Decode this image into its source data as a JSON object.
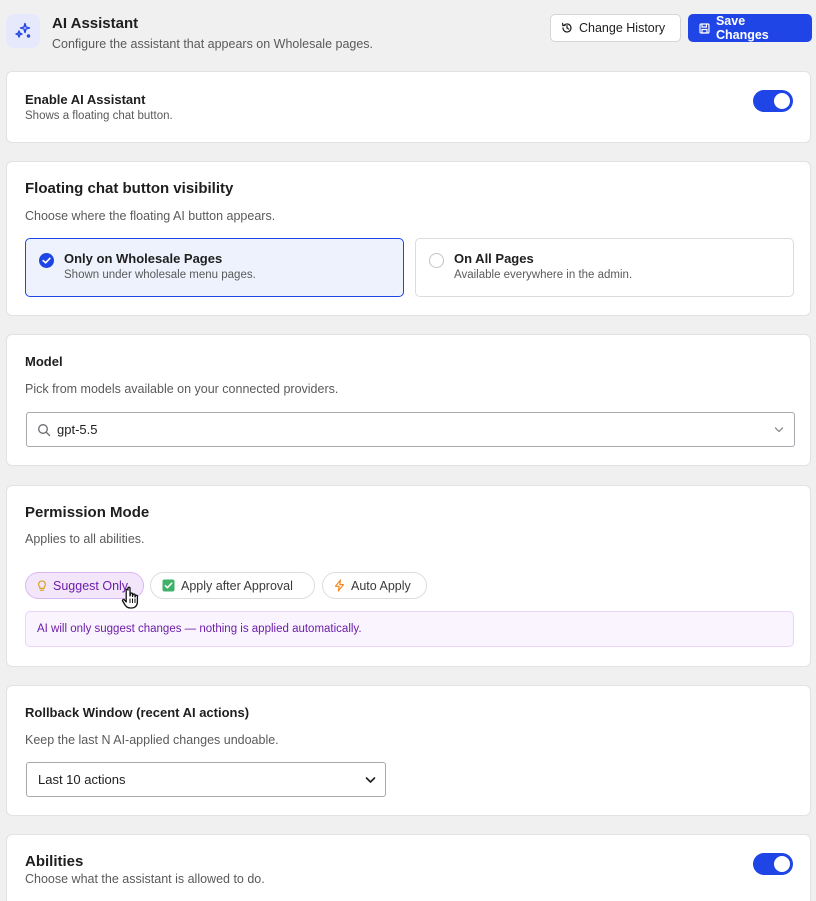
{
  "header": {
    "title": "AI Assistant",
    "subtitle": "Configure the assistant that appears on Wholesale pages.",
    "change_history_label": "Change History",
    "save_label": "Save Changes"
  },
  "enable": {
    "title": "Enable AI Assistant",
    "description": "Shows a floating chat button.",
    "enabled": true
  },
  "visibility": {
    "title": "Floating chat button visibility",
    "description": "Choose where the floating AI button appears.",
    "options": [
      {
        "label": "Only on Wholesale Pages",
        "sub": "Shown under wholesale menu pages.",
        "selected": true
      },
      {
        "label": "On All Pages",
        "sub": "Available everywhere in the admin.",
        "selected": false
      }
    ]
  },
  "model": {
    "title": "Model",
    "description": "Pick from models available on your connected providers.",
    "value": "gpt-5.5"
  },
  "permission": {
    "title": "Permission Mode",
    "description": "Applies to all abilities.",
    "modes": [
      {
        "label": "Suggest Only",
        "icon": "lightbulb-icon",
        "active": true
      },
      {
        "label": "Apply after Approval",
        "icon": "check-square-icon",
        "active": false
      },
      {
        "label": "Auto Apply",
        "icon": "lightning-icon",
        "active": false
      }
    ],
    "info": "AI will only suggest changes — nothing is applied automatically."
  },
  "rollback": {
    "title": "Rollback Window (recent AI actions)",
    "description": "Keep the last N AI-applied changes undoable.",
    "value": "Last 10 actions"
  },
  "abilities": {
    "title": "Abilities",
    "description": "Choose what the assistant is allowed to do.",
    "enabled": true
  },
  "colors": {
    "primary": "#2045e6",
    "suggest_accent": "#6d1ea8",
    "approval_green": "#3fb168",
    "auto_orange": "#f28c28"
  }
}
